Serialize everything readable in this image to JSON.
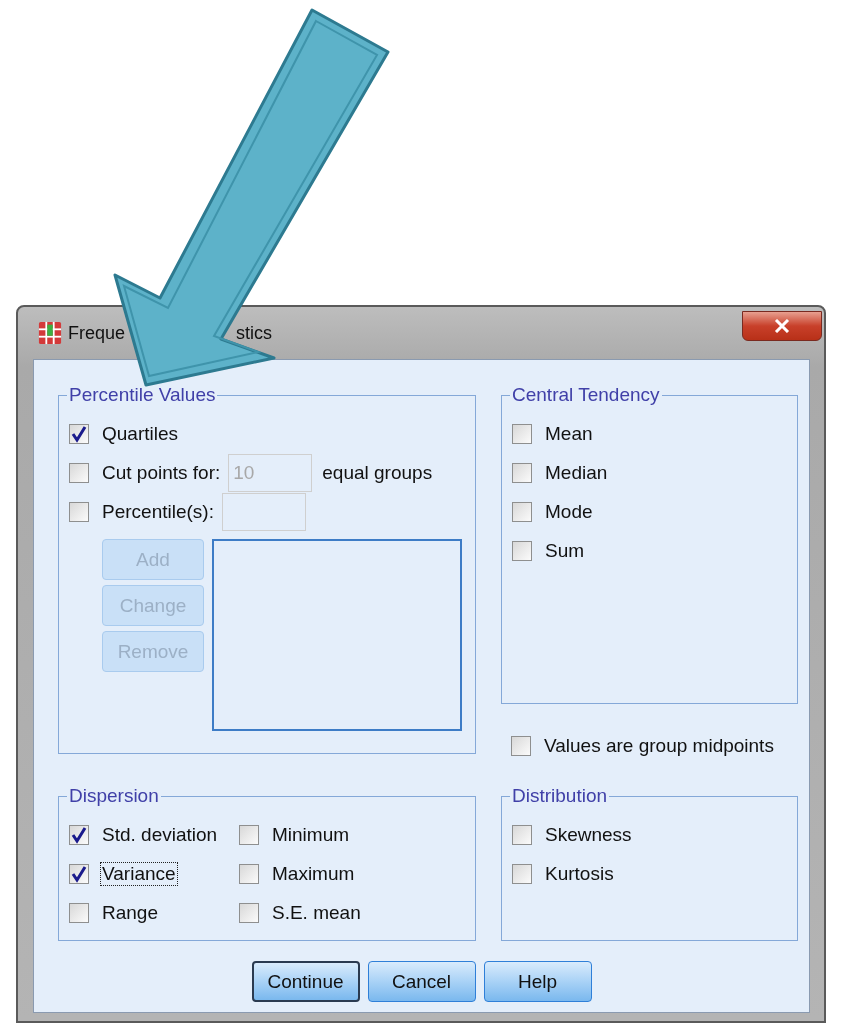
{
  "window": {
    "title_start": "Freque",
    "title_end": "stics"
  },
  "percentile_values": {
    "legend": "Percentile Values",
    "options": [
      {
        "kind": "checkbox",
        "label": "Quartiles",
        "checked": true
      },
      {
        "kind": "checkbox_field",
        "label": "Cut points for:",
        "checked": false,
        "field": {
          "value": "10",
          "disabled": true
        },
        "suffix": "equal groups"
      },
      {
        "kind": "checkbox_field",
        "label": "Percentile(s):",
        "checked": false,
        "field": {
          "disabled": true
        }
      }
    ],
    "buttons": [
      {
        "label": "Add",
        "disabled": true
      },
      {
        "label": "Change",
        "disabled": true
      },
      {
        "label": "Remove",
        "disabled": true
      }
    ]
  },
  "central_tendency": {
    "legend": "Central Tendency",
    "options": [
      {
        "label": "Mean",
        "checked": false
      },
      {
        "label": "Median",
        "checked": false
      },
      {
        "label": "Mode",
        "checked": false
      },
      {
        "label": "Sum",
        "checked": false
      }
    ]
  },
  "group_midpoints": {
    "label": "Values are group midpoints",
    "checked": false
  },
  "dispersion": {
    "legend": "Dispersion",
    "options": [
      {
        "label": "Std. deviation",
        "checked": true,
        "focused": false
      },
      {
        "label": "Minimum",
        "checked": false,
        "focused": false
      },
      {
        "label": "Variance",
        "checked": true,
        "focused": true
      },
      {
        "label": "Maximum",
        "checked": false,
        "focused": false
      },
      {
        "label": "Range",
        "checked": false,
        "focused": false
      },
      {
        "label": "S.E. mean",
        "checked": false,
        "focused": false
      }
    ]
  },
  "distribution": {
    "legend": "Distribution",
    "options": [
      {
        "label": "Skewness",
        "checked": false
      },
      {
        "label": "Kurtosis",
        "checked": false
      }
    ]
  },
  "buttons": [
    {
      "label": "Continue",
      "default": true,
      "disabled": false
    },
    {
      "label": "Cancel",
      "default": false,
      "disabled": false
    },
    {
      "label": "Help",
      "default": false,
      "disabled": false
    }
  ]
}
